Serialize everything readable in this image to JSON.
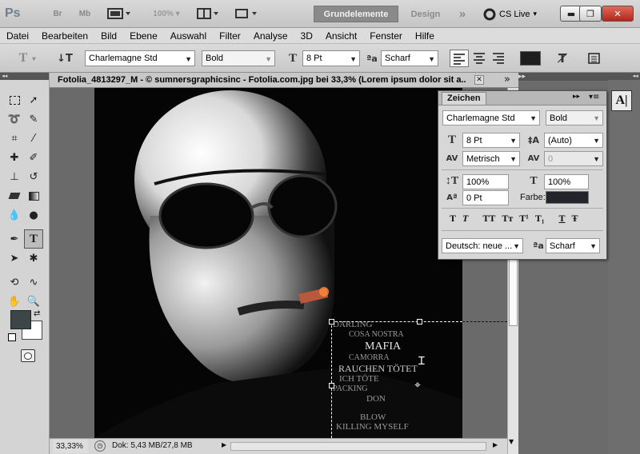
{
  "app": {
    "logo": "Ps",
    "buttons": [
      "Br",
      "Mb"
    ],
    "zoom": "100%",
    "workspaces": [
      "Grundelemente",
      "Design"
    ],
    "more": "»",
    "cslive": "CS Live"
  },
  "menu": [
    "Datei",
    "Bearbeiten",
    "Bild",
    "Ebene",
    "Auswahl",
    "Filter",
    "Analyse",
    "3D",
    "Ansicht",
    "Fenster",
    "Hilfe"
  ],
  "options": {
    "font_family": "Charlemagne Std",
    "font_style": "Bold",
    "font_size": "8 Pt",
    "antialias_label": "ªa",
    "antialias": "Scharf",
    "text_color": "#1e1e1e"
  },
  "document": {
    "title": "Fotolia_4813297_M - © sumnersgraphicsinc - Fotolia.com.jpg bei 33,3% (Lorem ipsum dolor sit a...",
    "tabs_more": "»",
    "zoom": "33,33%",
    "doc_info": "Dok: 5,43 MB/27,8 MB"
  },
  "image_text": {
    "lines": [
      "DARLING",
      "COSA NOSTRA",
      "MAFIA",
      "CAMORRA",
      "RAUCHEN TÖTET",
      "ICH TÖTE",
      "PACKING",
      "DON",
      "BLOW",
      "KILLING MYSELF"
    ]
  },
  "char_panel": {
    "title": "Zeichen",
    "font_family": "Charlemagne Std",
    "font_style": "Bold",
    "size": "8 Pt",
    "leading": "(Auto)",
    "kerning": "Metrisch",
    "tracking": "0",
    "vscale": "100%",
    "hscale": "100%",
    "baseline": "0 Pt",
    "color_label": "Farbe:",
    "color": "#24242c",
    "styles": [
      "T",
      "T",
      "TT",
      "Tт",
      "T¹",
      "T₁",
      "T",
      "Ŧ"
    ],
    "language": "Deutsch: neue ...",
    "aa_label": "ªa",
    "antialias": "Scharf"
  },
  "colors": {
    "foreground": "#3d4548",
    "background": "#ffffff"
  }
}
